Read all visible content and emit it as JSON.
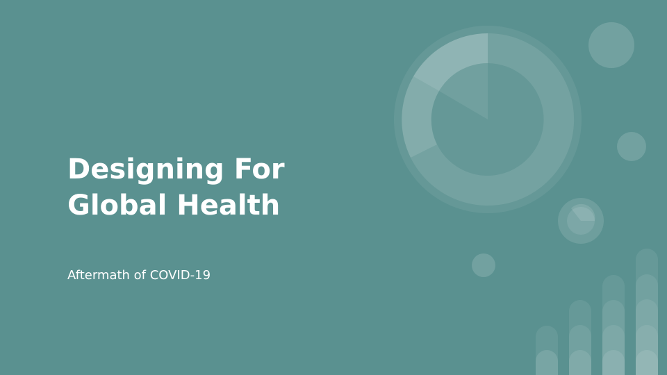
{
  "slide": {
    "title_line1": "Designing For",
    "title_line2": "Global Health",
    "subtitle": "Aftermath of COVID-19"
  },
  "colors": {
    "background": "#5a9190",
    "text": "#ffffff"
  }
}
